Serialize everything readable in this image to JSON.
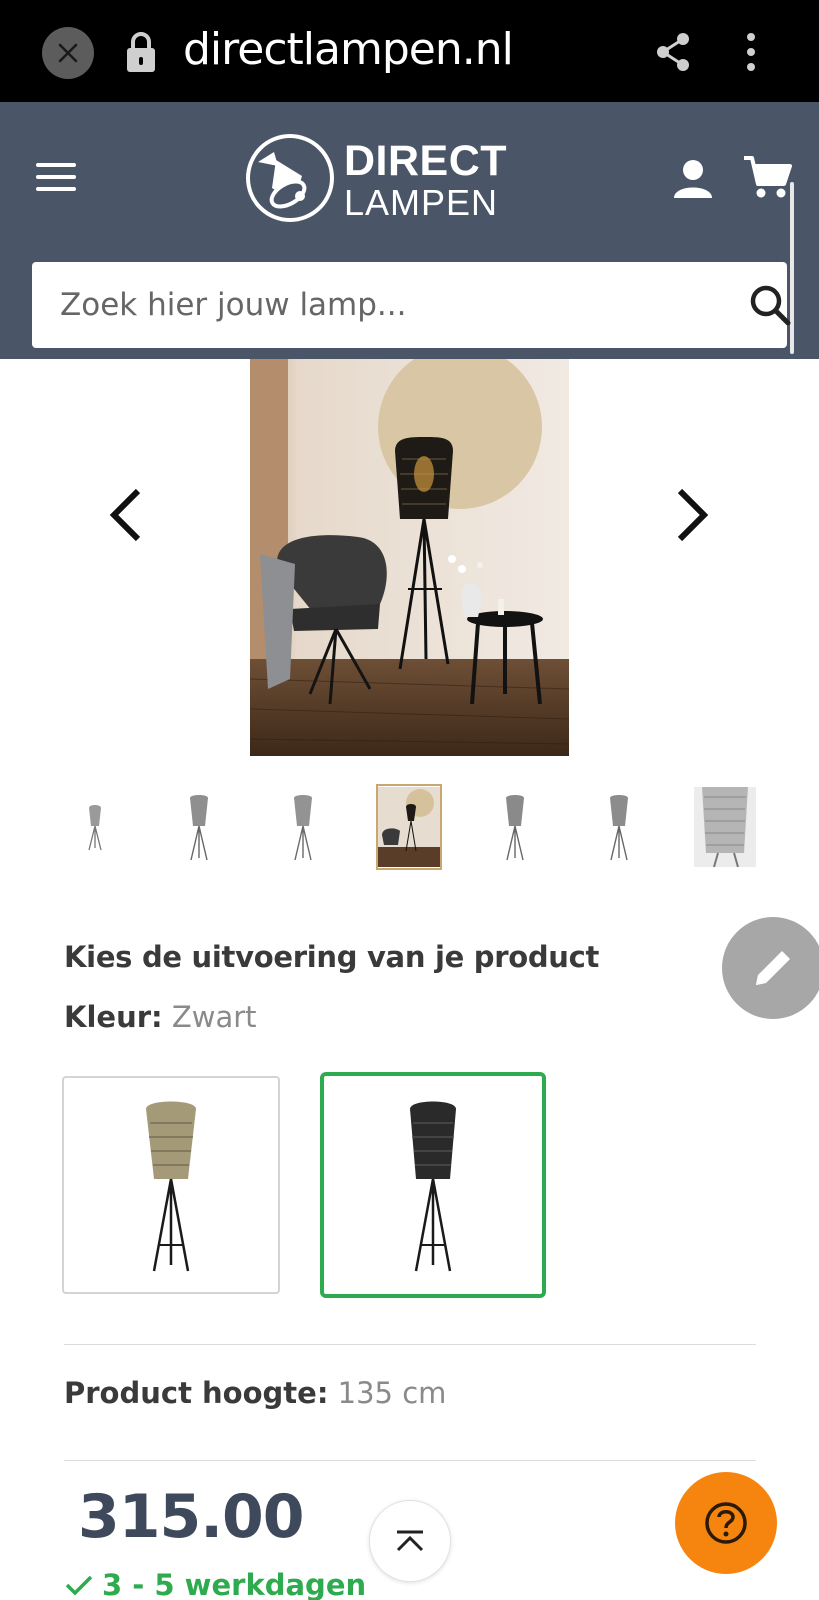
{
  "browser": {
    "url": "directlampen.nl"
  },
  "header": {
    "logo_line1": "DIRECT",
    "logo_line2": "LAMPEN",
    "search_placeholder": "Zoek hier jouw lamp..."
  },
  "gallery": {
    "thumbnail_count": 7,
    "selected_thumbnail": 4
  },
  "variant": {
    "title": "Kies de uitvoering van je product",
    "color_label": "Kleur:",
    "color_value": "Zwart",
    "options": [
      "goud",
      "zwart"
    ],
    "selected_option": 2
  },
  "specs": {
    "height_label": "Product hoogte:",
    "height_value": "135 cm"
  },
  "price": {
    "amount": "315.00"
  },
  "delivery": {
    "text": "3 - 5 werkdagen"
  },
  "colors": {
    "header_bg": "#4a5668",
    "accent_green": "#2eaa4f",
    "help_orange": "#f6850f",
    "price_color": "#3e4a5c"
  }
}
